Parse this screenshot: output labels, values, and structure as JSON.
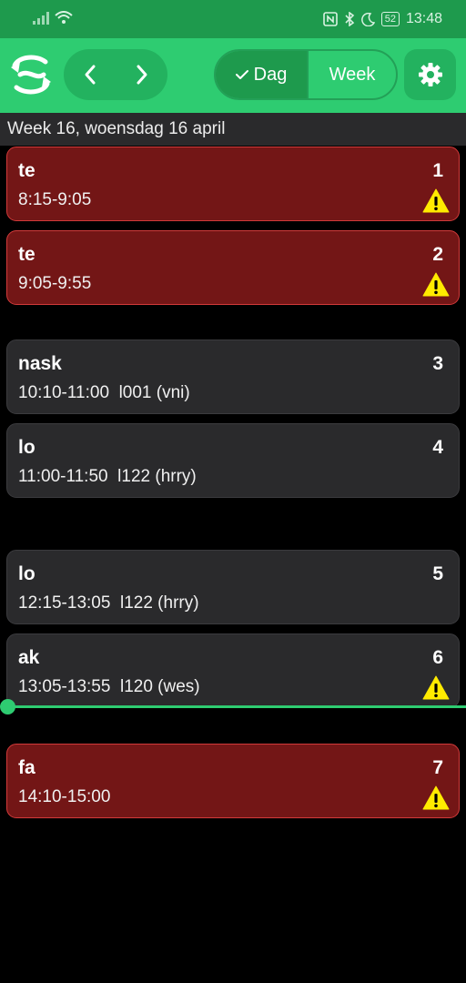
{
  "status_bar": {
    "time": "13:48",
    "battery": "52"
  },
  "toolbar": {
    "view_day_label": "Dag",
    "view_week_label": "Week"
  },
  "date_header": "Week 16, woensdag 16 april",
  "lessons": [
    {
      "subject": "te",
      "hour": "1",
      "time": "8:15-9:05",
      "location": "",
      "cancelled": true,
      "warning": true
    },
    {
      "subject": "te",
      "hour": "2",
      "time": "9:05-9:55",
      "location": "",
      "cancelled": true,
      "warning": true
    },
    {
      "subject": "nask",
      "hour": "3",
      "time": "10:10-11:00",
      "location": "l001 (vni)",
      "cancelled": false,
      "warning": false
    },
    {
      "subject": "lo",
      "hour": "4",
      "time": "11:00-11:50",
      "location": "l122 (hrry)",
      "cancelled": false,
      "warning": false
    },
    {
      "subject": "lo",
      "hour": "5",
      "time": "12:15-13:05",
      "location": "l122 (hrry)",
      "cancelled": false,
      "warning": false
    },
    {
      "subject": "ak",
      "hour": "6",
      "time": "13:05-13:55",
      "location": "l120 (wes)",
      "cancelled": false,
      "warning": true
    },
    {
      "subject": "fa",
      "hour": "7",
      "time": "14:10-15:00",
      "location": "",
      "cancelled": true,
      "warning": true
    }
  ],
  "colors": {
    "accent": "#2ecc71",
    "cancelled_bg": "#731616",
    "cancelled_border": "#d23a3a",
    "card_bg": "#2a2a2c",
    "warning": "#ffeb00"
  },
  "icons": {
    "logo": "app-logo-icon",
    "prev": "chevron-left-icon",
    "next": "chevron-right-icon",
    "check": "check-icon",
    "settings": "gear-icon",
    "warning": "warning-icon"
  }
}
